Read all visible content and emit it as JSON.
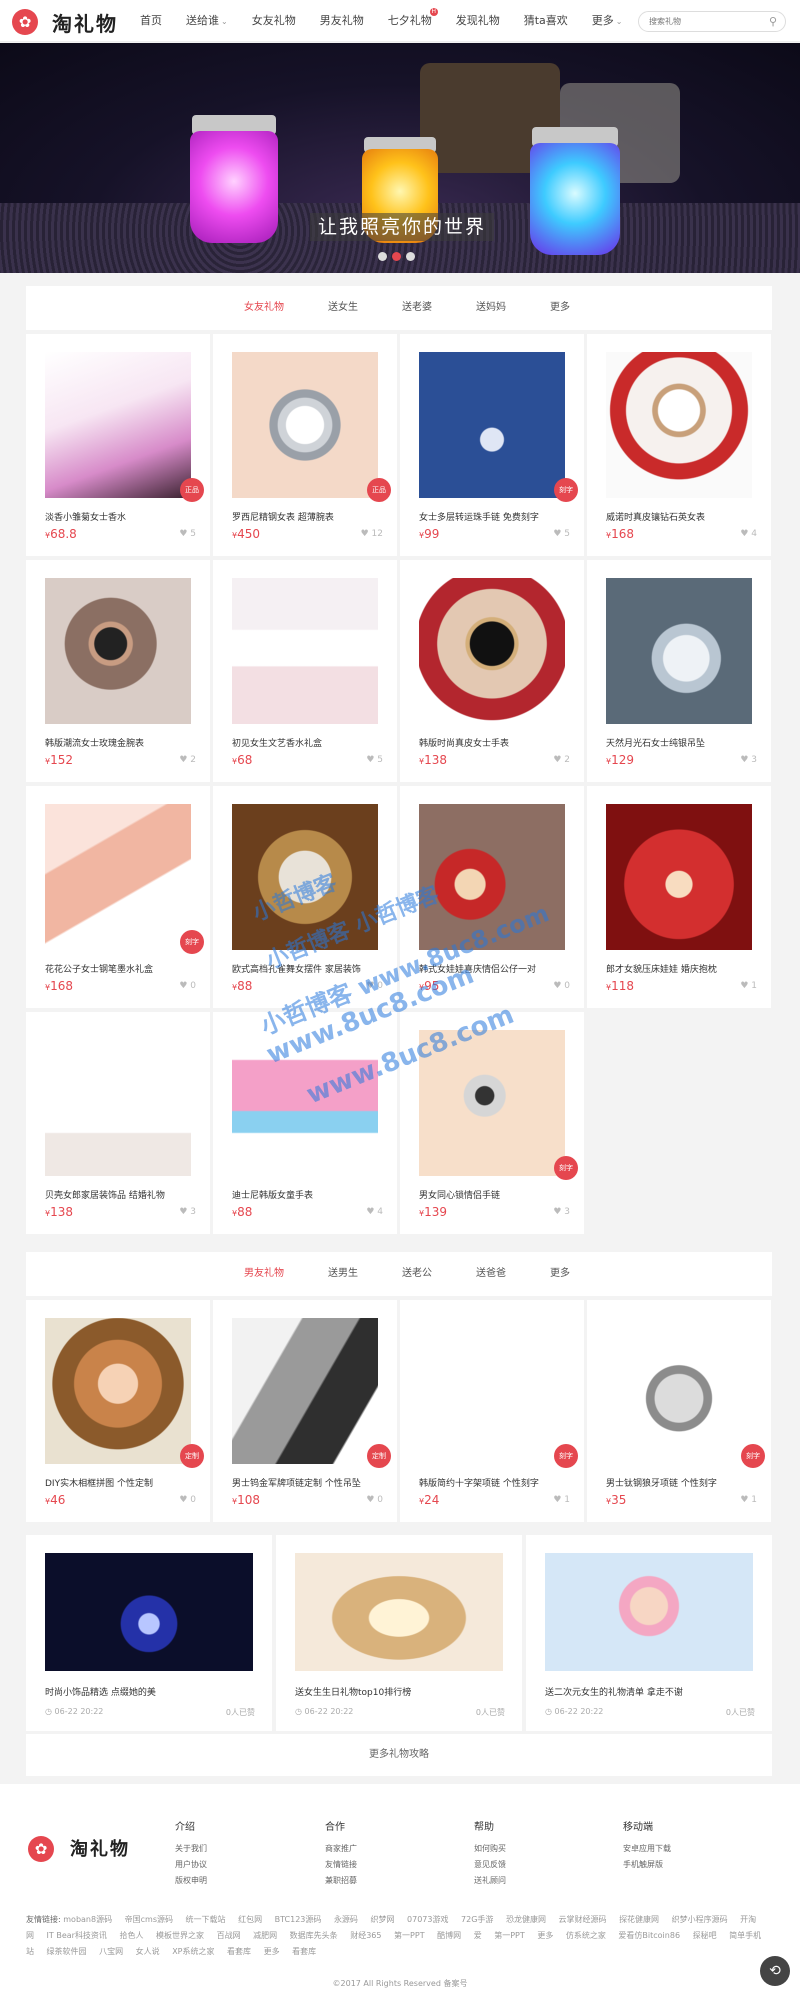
{
  "header": {
    "logo_text": "淘礼物",
    "nav": [
      "首页",
      "送给谁",
      "女友礼物",
      "男友礼物",
      "七夕礼物",
      "发现礼物",
      "猜ta喜欢",
      "更多"
    ],
    "search_placeholder": "搜索礼物"
  },
  "banner": {
    "slogan": "让我照亮你的世界",
    "slide_count": 3,
    "active_slide": 1
  },
  "section1": {
    "tabs": [
      "女友礼物",
      "送女生",
      "送老婆",
      "送妈妈",
      "更多"
    ],
    "products": [
      {
        "name": "淡香小雏菊女士香水",
        "price": "68.8",
        "likes": "5",
        "badge": "正品",
        "img": "perfume"
      },
      {
        "name": "罗西尼精钢女表 超薄腕表",
        "price": "450",
        "likes": "12",
        "badge": "正品",
        "img": "watch-steel"
      },
      {
        "name": "女士多层转运珠手链 免费刻字",
        "price": "99",
        "likes": "5",
        "badge": "刻字",
        "img": "bracelet"
      },
      {
        "name": "威诺时真皮镶钻石英女表",
        "price": "168",
        "likes": "4",
        "badge": "",
        "img": "watch-red"
      },
      {
        "name": "韩版潮流女士玫瑰金腕表",
        "price": "152",
        "likes": "2",
        "badge": "",
        "img": "watch-wrist"
      },
      {
        "name": "初见女生文艺香水礼盒",
        "price": "68",
        "likes": "5",
        "badge": "",
        "img": "perfume-box"
      },
      {
        "name": "韩版时尚真皮女士手表",
        "price": "138",
        "likes": "2",
        "badge": "",
        "img": "watch-black"
      },
      {
        "name": "天然月光石女士纯银吊坠",
        "price": "129",
        "likes": "3",
        "badge": "",
        "img": "moonstone"
      },
      {
        "name": "花花公子女士钢笔墨水礼盒",
        "price": "168",
        "likes": "0",
        "badge": "刻字",
        "img": "pen-box"
      },
      {
        "name": "欧式高档孔雀舞女摆件 家居装饰",
        "price": "88",
        "likes": "0",
        "badge": "",
        "img": "peacock"
      },
      {
        "name": "韩式女娃娃喜庆情侣公仔一对",
        "price": "95",
        "likes": "0",
        "badge": "",
        "img": "dolls"
      },
      {
        "name": "郎才女貌压床娃娃 婚庆抱枕",
        "price": "118",
        "likes": "1",
        "badge": "",
        "img": "dolls-red"
      },
      {
        "name": "贝壳女郎家居装饰品 结婚礼物",
        "price": "138",
        "likes": "3",
        "badge": "",
        "img": "dancers"
      },
      {
        "name": "迪士尼韩版女童手表",
        "price": "88",
        "likes": "4",
        "badge": "",
        "img": "kids-watch"
      },
      {
        "name": "男女同心锁情侣手链",
        "price": "139",
        "likes": "3",
        "badge": "刻字",
        "img": "lock"
      }
    ]
  },
  "section2": {
    "tabs": [
      "男友礼物",
      "送男生",
      "送老公",
      "送爸爸",
      "更多"
    ],
    "products": [
      {
        "name": "DIY实木相框拼图 个性定制",
        "price": "46",
        "likes": "0",
        "badge": "定制",
        "img": "frame"
      },
      {
        "name": "男士钨金军牌项链定制 个性吊坠",
        "price": "108",
        "likes": "0",
        "badge": "定制",
        "img": "dogtag"
      },
      {
        "name": "韩版简约十字架项链 个性刻字",
        "price": "24",
        "likes": "1",
        "badge": "刻字",
        "img": "cross"
      },
      {
        "name": "男士钛钢狼牙项链 个性刻字",
        "price": "35",
        "likes": "1",
        "badge": "刻字",
        "img": "fang"
      }
    ],
    "articles": [
      {
        "title": "时尚小饰品精选 点缀她的美",
        "time": "06-22 20:22",
        "reads": "0人已赞",
        "img": "crystal"
      },
      {
        "title": "送女生生日礼物top10排行榜",
        "time": "06-22 20:22",
        "reads": "0人已赞",
        "img": "bracelet-gold"
      },
      {
        "title": "送二次元女生的礼物清单 拿走不谢",
        "time": "06-22 20:22",
        "reads": "0人已赞",
        "img": "girl"
      }
    ],
    "more_label": "更多礼物攻略"
  },
  "footer": {
    "logo_text": "淘礼物",
    "columns": [
      {
        "title": "介绍",
        "links": [
          "关于我们",
          "用户协议",
          "版权申明"
        ]
      },
      {
        "title": "合作",
        "links": [
          "商家推广",
          "友情链接",
          "兼职招募"
        ]
      },
      {
        "title": "帮助",
        "links": [
          "如何购买",
          "意见反馈",
          "送礼顾问"
        ]
      },
      {
        "title": "移动端",
        "links": [
          "安卓应用下载",
          "手机触屏版"
        ]
      }
    ],
    "friend_label": "友情链接:",
    "friend_links": [
      "moban8源码",
      "帝国cms源码",
      "统一下载站",
      "红包网",
      "BTC123源码",
      "永源码",
      "织梦网",
      "07073游戏",
      "72G手游",
      "恐龙健康网",
      "云掌财经源码",
      "探花健康网",
      "织梦小程序源码",
      "开淘网",
      "IT Bear科技资讯",
      "拾色人",
      "模板世界之家",
      "百战网",
      "减肥网",
      "数据库先头条",
      "财经365",
      "第一PPT",
      "酷博网",
      "爱",
      "第一PPT",
      "更多",
      "仿系统之家",
      "爱看仿Bitcoin86",
      "探秘吧",
      "简单手机站",
      "绿茶软件园",
      "八宝网",
      "女人说",
      "XP系统之家",
      "看套库",
      "更多",
      "看套库"
    ],
    "copyright": "©2017 All Rights Reserved  备案号",
    "watermark": [
      "小哲博客",
      "小哲博客 小哲博客",
      "小哲博客 www.8uc8.com",
      "www.8uc8.com",
      "www.8uc8.com"
    ]
  },
  "colors": {
    "accent": "#e5474f",
    "bg": "#f3f3f3",
    "card": "#ffffff"
  }
}
